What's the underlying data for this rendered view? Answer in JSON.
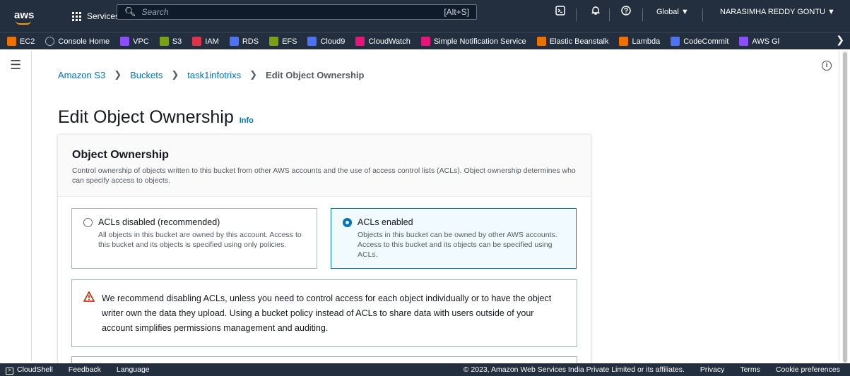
{
  "topnav": {
    "logo": "aws",
    "services_label": "Services",
    "search_placeholder": "Search",
    "search_shortcut": "[Alt+S]",
    "region": "Global ▼",
    "account": "NARASIMHA REDDY GONTU ▼"
  },
  "favorites": [
    {
      "label": "EC2",
      "color": "#ed7100"
    },
    {
      "label": "Console Home",
      "color": ""
    },
    {
      "label": "VPC",
      "color": "#8c4fff"
    },
    {
      "label": "S3",
      "color": "#7aa116"
    },
    {
      "label": "IAM",
      "color": "#dd344c"
    },
    {
      "label": "RDS",
      "color": "#4d72f3"
    },
    {
      "label": "EFS",
      "color": "#7aa116"
    },
    {
      "label": "Cloud9",
      "color": "#4d72f3"
    },
    {
      "label": "CloudWatch",
      "color": "#e7157b"
    },
    {
      "label": "Simple Notification Service",
      "color": "#e7157b"
    },
    {
      "label": "Elastic Beanstalk",
      "color": "#ed7100"
    },
    {
      "label": "Lambda",
      "color": "#ed7100"
    },
    {
      "label": "CodeCommit",
      "color": "#4d72f3"
    },
    {
      "label": "AWS Gl",
      "color": "#8c4fff"
    }
  ],
  "breadcrumb": {
    "item1": "Amazon S3",
    "item2": "Buckets",
    "item3": "task1infotrixs",
    "current": "Edit Object Ownership"
  },
  "page": {
    "title": "Edit Object Ownership",
    "info": "Info"
  },
  "section": {
    "title": "Object Ownership",
    "description": "Control ownership of objects written to this bucket from other AWS accounts and the use of access control lists (ACLs). Object ownership determines who can specify access to objects."
  },
  "options": {
    "disabled": {
      "label": "ACLs disabled (recommended)",
      "desc": "All objects in this bucket are owned by this account. Access to this bucket and its objects is specified using only policies."
    },
    "enabled": {
      "label": "ACLs enabled",
      "desc": "Objects in this bucket can be owned by other AWS accounts. Access to this bucket and its objects can be specified using ACLs."
    }
  },
  "alert": {
    "message": "We recommend disabling ACLs, unless you need to control access for each object individually or to have the object writer own the data they upload. Using a bucket policy instead of ACLs to share data with users outside of your account simplifies permissions management and auditing."
  },
  "footer": {
    "cloudshell": "CloudShell",
    "feedback": "Feedback",
    "language": "Language",
    "copyright": "© 2023, Amazon Web Services India Private Limited or its affiliates.",
    "privacy": "Privacy",
    "terms": "Terms",
    "cookies": "Cookie preferences"
  }
}
